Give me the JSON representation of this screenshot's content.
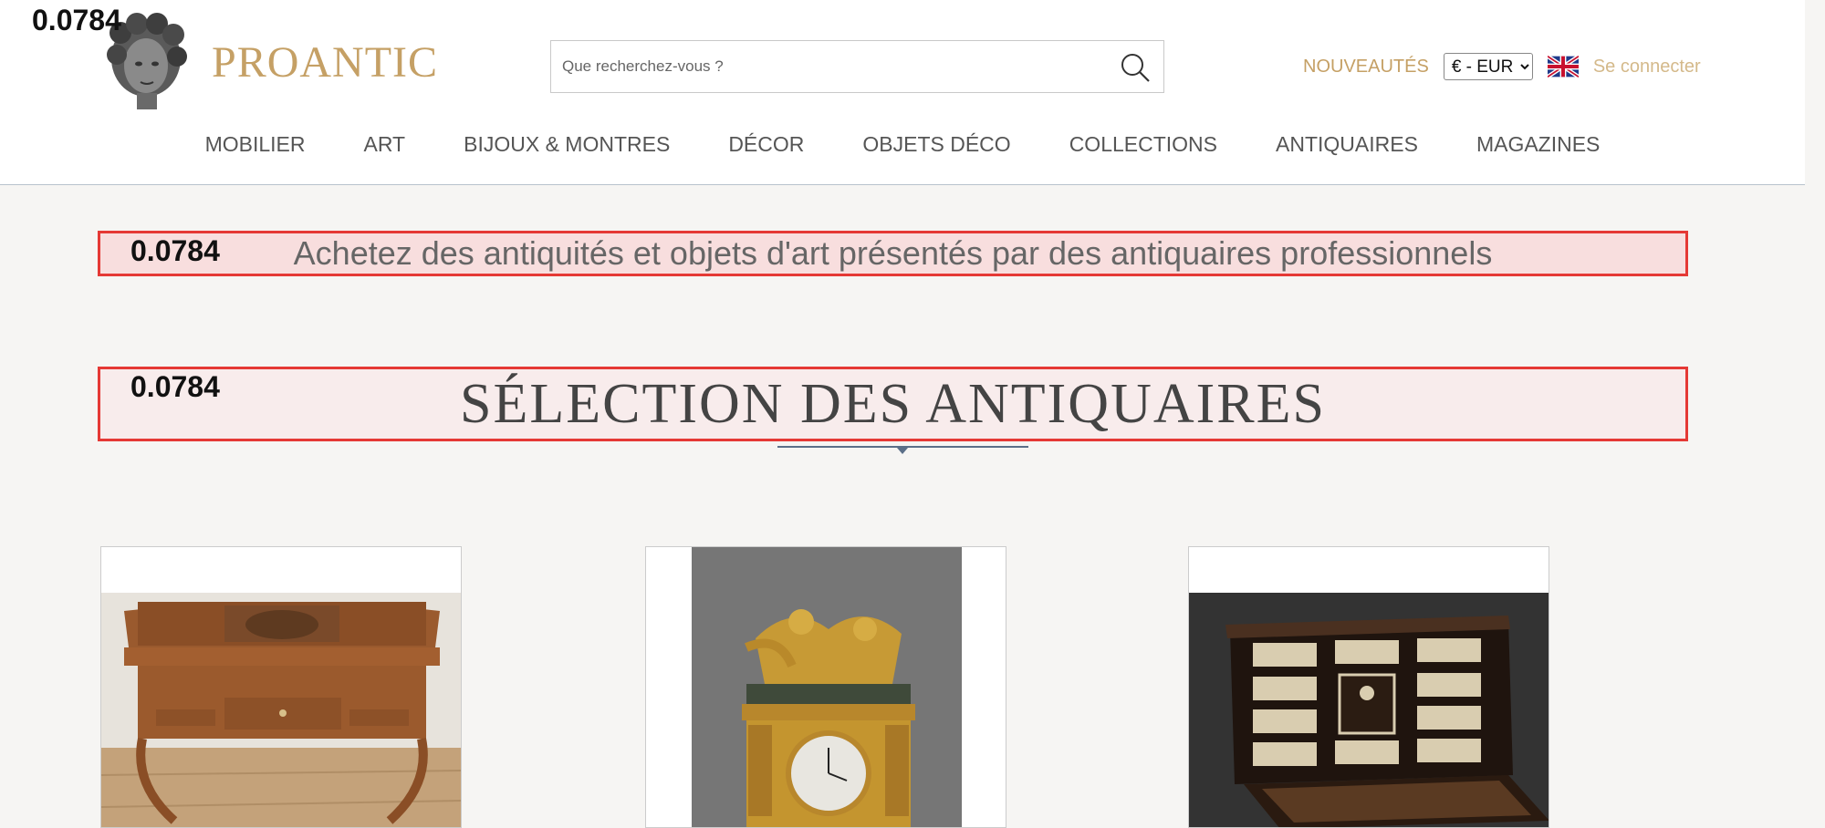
{
  "overlay": {
    "marker_value": "0.0784"
  },
  "header": {
    "logo_text": "PROANTIC",
    "search_placeholder": "Que recherchez-vous ?",
    "new_label": "NOUVEAUTÉS",
    "currency_selected": "€ - EUR",
    "login_label": "Se connecter",
    "accent_color": "#c5a065"
  },
  "nav": {
    "items": [
      {
        "label": "MOBILIER"
      },
      {
        "label": "ART"
      },
      {
        "label": "BIJOUX & MONTRES"
      },
      {
        "label": "DÉCOR"
      },
      {
        "label": "OBJETS DÉCO"
      },
      {
        "label": "COLLECTIONS"
      },
      {
        "label": "ANTIQUAIRES"
      },
      {
        "label": "MAGAZINES"
      }
    ]
  },
  "main": {
    "tagline": "Achetez des antiquités et objets d'art présentés par des antiquaires professionnels",
    "section_title": "SÉLECTION DES ANTIQUAIRES",
    "highlight_color": "#e53935"
  },
  "cards": [
    {
      "icon": "dressing-table-image"
    },
    {
      "icon": "gilt-clock-image"
    },
    {
      "icon": "cabinet-image"
    }
  ]
}
